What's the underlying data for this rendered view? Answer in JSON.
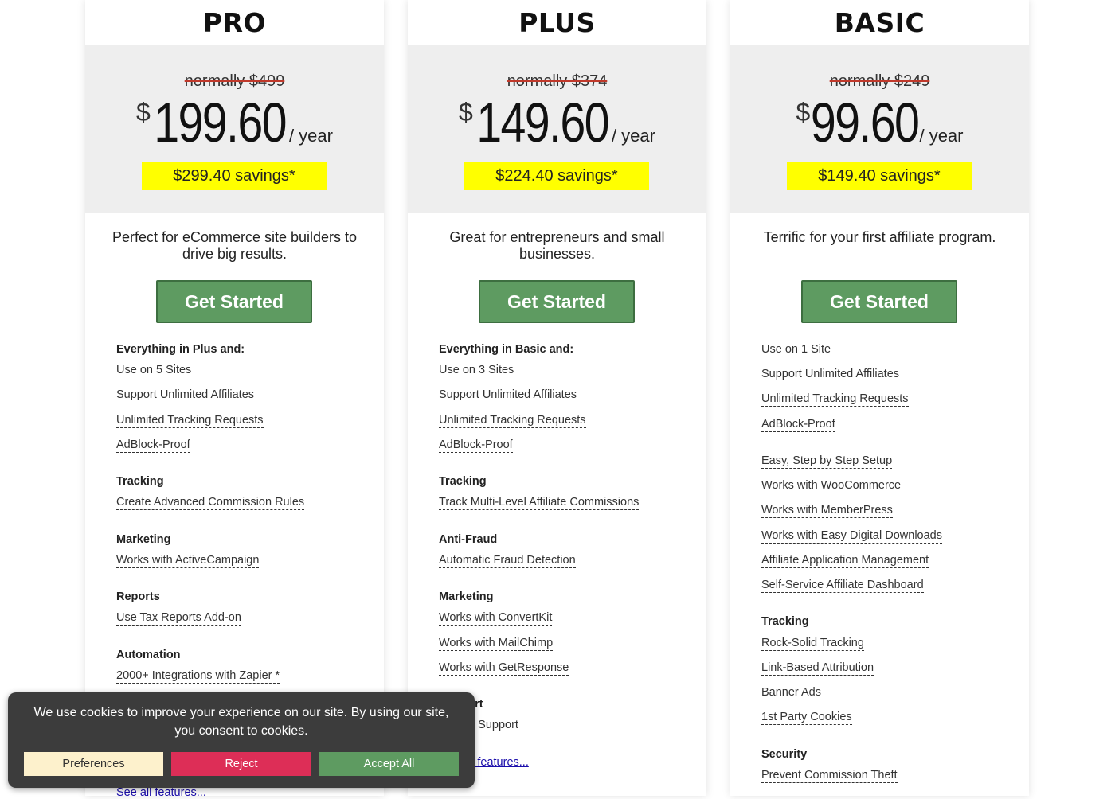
{
  "plans": [
    {
      "name": "PRO",
      "normally": "normally $499",
      "currency": "$",
      "price": "199.60",
      "period": "/ year",
      "savings": "$299.40 savings*",
      "tagline": "Perfect for eCommerce site builders to drive big results.",
      "cta": "Get Started",
      "features": [
        {
          "text": "Everything in Plus and:",
          "kind": "head"
        },
        {
          "text": "Use on 5 Sites",
          "kind": "plain"
        },
        {
          "text": "Support Unlimited Affiliates",
          "kind": "plain"
        },
        {
          "text": "Unlimited Tracking Requests",
          "kind": "ul"
        },
        {
          "text": "AdBlock-Proof",
          "kind": "ul"
        },
        {
          "text": "Tracking",
          "kind": "head"
        },
        {
          "text": "Create Advanced Commission Rules",
          "kind": "ul"
        },
        {
          "text": "Marketing",
          "kind": "head"
        },
        {
          "text": "Works with ActiveCampaign",
          "kind": "ul"
        },
        {
          "text": "Reports",
          "kind": "head"
        },
        {
          "text": "Use Tax Reports Add-on",
          "kind": "ul"
        },
        {
          "text": "Automation",
          "kind": "head"
        },
        {
          "text": "2000+ Integrations with Zapier *",
          "kind": "ul"
        },
        {
          "text": "See all features...",
          "kind": "link"
        }
      ]
    },
    {
      "name": "PLUS",
      "normally": "normally $374",
      "currency": "$",
      "price": "149.60",
      "period": "/ year",
      "savings": "$224.40 savings*",
      "tagline": "Great for entrepreneurs and small businesses.",
      "cta": "Get Started",
      "features": [
        {
          "text": "Everything in Basic and:",
          "kind": "head"
        },
        {
          "text": "Use on 3 Sites",
          "kind": "plain"
        },
        {
          "text": "Support Unlimited Affiliates",
          "kind": "plain"
        },
        {
          "text": "Unlimited Tracking Requests",
          "kind": "ul"
        },
        {
          "text": "AdBlock-Proof",
          "kind": "ul"
        },
        {
          "text": "Tracking",
          "kind": "head"
        },
        {
          "text": "Track Multi-Level Affiliate Commissions",
          "kind": "ul"
        },
        {
          "text": "Anti-Fraud",
          "kind": "head"
        },
        {
          "text": "Automatic Fraud Detection",
          "kind": "ul"
        },
        {
          "text": "Marketing",
          "kind": "head"
        },
        {
          "text": "Works with ConvertKit",
          "kind": "ul"
        },
        {
          "text": "Works with MailChimp",
          "kind": "ul"
        },
        {
          "text": "Works with GetResponse",
          "kind": "ul"
        },
        {
          "text": "Support",
          "kind": "head"
        },
        {
          "text": "Priority Support",
          "kind": "plain"
        },
        {
          "text": "See all features...",
          "kind": "link"
        }
      ]
    },
    {
      "name": "BASIC",
      "normally": "normally $249",
      "currency": "$",
      "price": "99.60",
      "period": "/ year",
      "savings": "$149.40 savings*",
      "tagline": "Terrific for your first affiliate program.",
      "cta": "Get Started",
      "features": [
        {
          "text": "Use on 1 Site",
          "kind": "plain"
        },
        {
          "text": "Support Unlimited Affiliates",
          "kind": "plain"
        },
        {
          "text": "Unlimited Tracking Requests",
          "kind": "ul"
        },
        {
          "text": "AdBlock-Proof",
          "kind": "ul"
        },
        {
          "text": "Easy, Step by Step Setup",
          "kind": "ul"
        },
        {
          "text": "Works with WooCommerce",
          "kind": "ul"
        },
        {
          "text": "Works with MemberPress",
          "kind": "ul"
        },
        {
          "text": "Works with Easy Digital Downloads",
          "kind": "ul"
        },
        {
          "text": "Affiliate Application Management",
          "kind": "ul"
        },
        {
          "text": "Self-Service Affiliate Dashboard",
          "kind": "ul"
        },
        {
          "text": "Tracking",
          "kind": "head"
        },
        {
          "text": "Rock-Solid Tracking",
          "kind": "ul"
        },
        {
          "text": "Link-Based Attribution",
          "kind": "ul"
        },
        {
          "text": "Banner Ads",
          "kind": "ul"
        },
        {
          "text": "1st Party Cookies",
          "kind": "ul"
        },
        {
          "text": "Security",
          "kind": "head"
        },
        {
          "text": "Prevent Commission Theft",
          "kind": "ul"
        }
      ]
    }
  ],
  "cookie_banner": {
    "message": "We use cookies to improve your experience on our site. By using our site, you consent to cookies.",
    "preferences": "Preferences",
    "reject": "Reject",
    "accept": "Accept All"
  },
  "colors": {
    "cta_green": "#5e9b61",
    "savings_yellow": "#ffff00",
    "reject_red": "#dd2e57",
    "preferences_cream": "#fdf1cc"
  }
}
